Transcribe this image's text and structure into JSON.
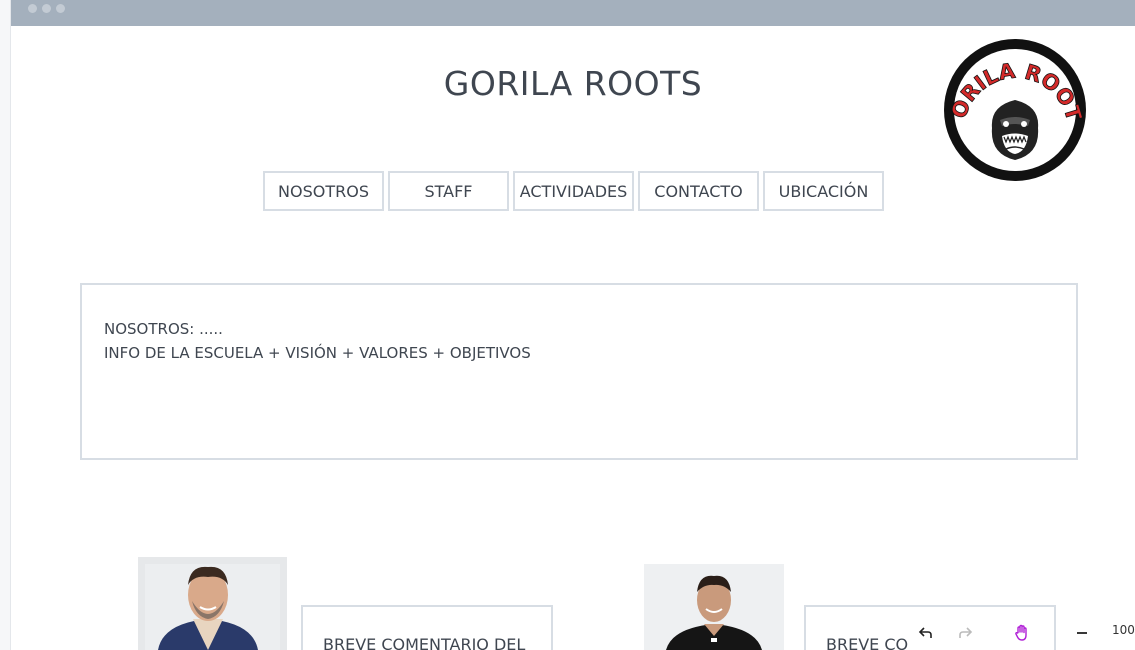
{
  "site": {
    "title": "GORILA ROOTS",
    "logo_text": "GORILA ROOTS"
  },
  "nav": {
    "items": [
      {
        "label": "NOSOTROS"
      },
      {
        "label": "STAFF"
      },
      {
        "label": "ACTIVIDADES"
      },
      {
        "label": "CONTACTO"
      },
      {
        "label": "UBICACIÓN"
      }
    ]
  },
  "about": {
    "line1": "NOSOTROS: .....",
    "line2": "INFO DE LA ESCUELA + VISIÓN + VALORES + OBJETIVOS"
  },
  "staff": [
    {
      "comment": "BREVE COMENTARIO DEL"
    },
    {
      "comment": "BREVE CO"
    }
  ],
  "toolbar": {
    "zoom": "100"
  },
  "colors": {
    "titlebar": "#a4b0bd",
    "border": "#d7dde4",
    "logo_red": "#d42a2a",
    "hand_tool": "#b01fd6"
  }
}
